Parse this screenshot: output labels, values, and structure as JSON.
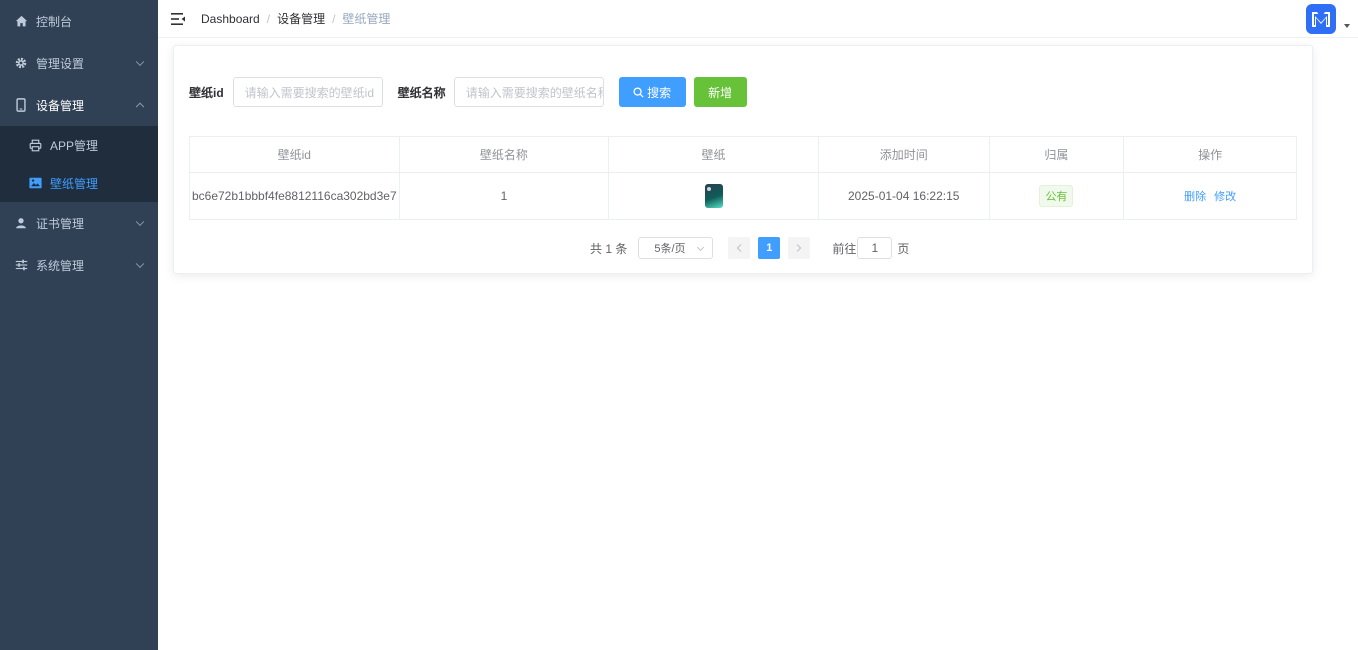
{
  "sidebar": {
    "items": [
      {
        "label": "控制台",
        "icon": "home-icon"
      },
      {
        "label": "管理设置",
        "icon": "gear-icon"
      },
      {
        "label": "设备管理",
        "icon": "tablet-icon"
      },
      {
        "label": "证书管理",
        "icon": "user-icon"
      },
      {
        "label": "系统管理",
        "icon": "sliders-icon"
      }
    ],
    "submenu": [
      {
        "label": "APP管理",
        "icon": "printer-icon"
      },
      {
        "label": "壁纸管理",
        "icon": "picture-icon"
      }
    ],
    "active_color": "#409eff"
  },
  "header": {
    "breadcrumb": [
      "Dashboard",
      "设备管理",
      "壁纸管理"
    ],
    "separator": "/"
  },
  "search": {
    "id_label": "壁纸id",
    "id_placeholder": "请输入需要搜索的壁纸id",
    "name_label": "壁纸名称",
    "name_placeholder": "请输入需要搜索的壁纸名称",
    "search_button": "搜索",
    "add_button": "新增"
  },
  "table": {
    "columns": [
      "壁纸id",
      "壁纸名称",
      "壁纸",
      "添加时间",
      "归属",
      "操作"
    ],
    "rows": [
      {
        "id": "bc6e72b1bbbf4fe8812116ca302bd3e7",
        "name": "1",
        "created": "2025-01-04 16:22:15",
        "owner": "公有",
        "delete": "删除",
        "edit": "修改"
      }
    ]
  },
  "pagination": {
    "total": "共 1 条",
    "page_size": "5条/页",
    "current_page": "1",
    "goto_prefix": "前往",
    "goto_value": "1",
    "goto_suffix": "页"
  }
}
